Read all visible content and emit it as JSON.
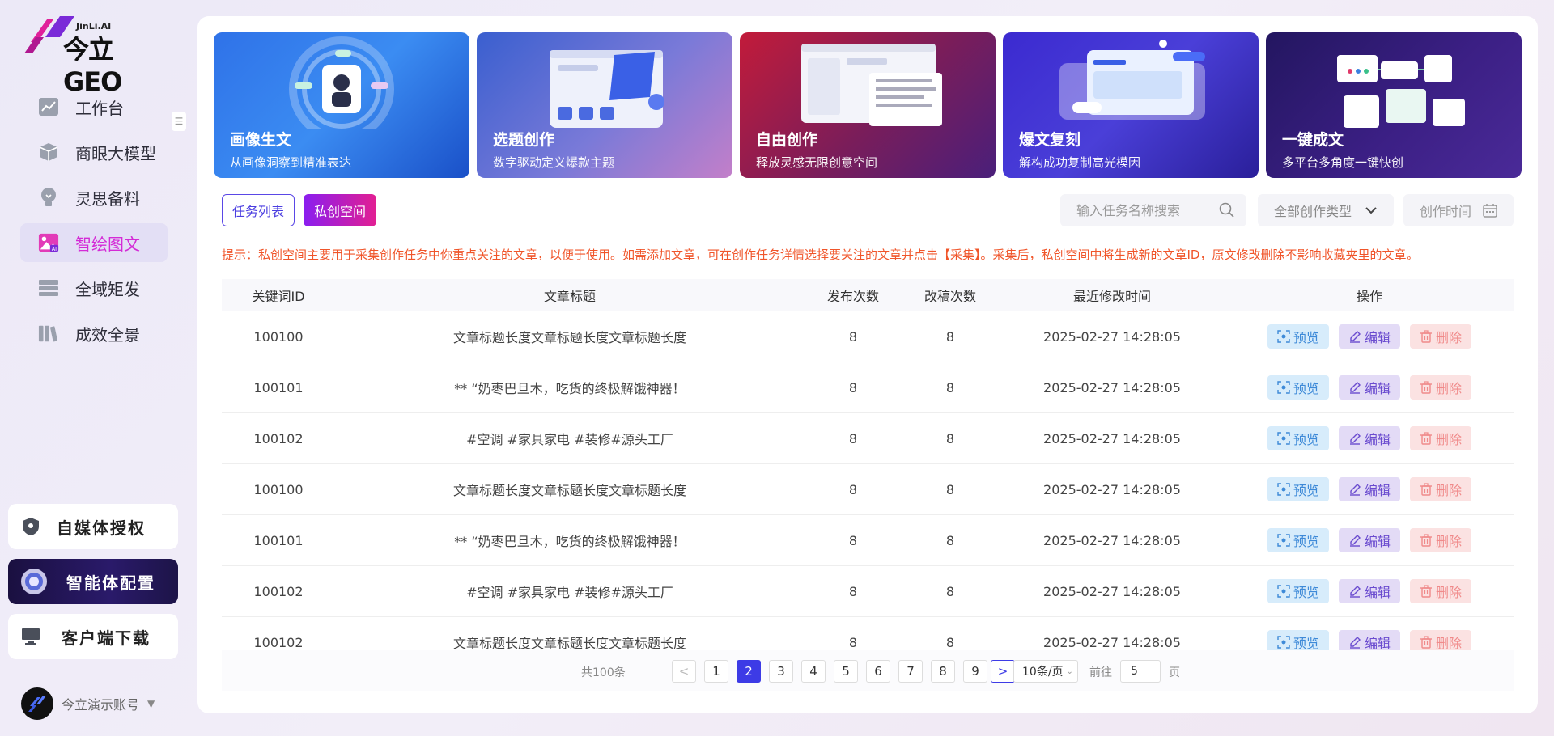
{
  "logo": {
    "small": "JinLi.AI",
    "big": "今立GEO"
  },
  "nav": [
    {
      "label": "工作台",
      "icon": "chart-line-icon"
    },
    {
      "label": "商眼大模型",
      "icon": "cube-icon"
    },
    {
      "label": "灵思备料",
      "icon": "lightbulb-icon"
    },
    {
      "label": "智绘图文",
      "icon": "ai-image-icon",
      "active": true
    },
    {
      "label": "全域矩发",
      "icon": "stack-icon"
    },
    {
      "label": "成效全景",
      "icon": "books-icon"
    }
  ],
  "side_cards": {
    "media_auth": "自媒体授权",
    "agent_config": "智能体配置",
    "client_download": "客户端下载"
  },
  "account": {
    "name": "今立演示账号"
  },
  "banners": [
    {
      "title": "画像生文",
      "subtitle": "从画像洞察到精准表达"
    },
    {
      "title": "选题创作",
      "subtitle": "数字驱动定义爆款主题"
    },
    {
      "title": "自由创作",
      "subtitle": "释放灵感无限创意空间"
    },
    {
      "title": "爆文复刻",
      "subtitle": "解构成功复制高光模因"
    },
    {
      "title": "一键成文",
      "subtitle": "多平台多角度一键快创"
    }
  ],
  "tabs": {
    "task_list": "任务列表",
    "private_space": "私创空间"
  },
  "filters": {
    "search_placeholder": "输入任务名称搜索",
    "type_select": "全部创作类型",
    "date_picker": "创作时间"
  },
  "tip": "提示：私创空间主要用于采集创作任务中你重点关注的文章，以便于使用。如需添加文章，可在创作任务详情选择要关注的文章并点击【采集】。采集后，私创空间中将生成新的文章ID，原文修改删除不影响收藏夹里的文章。",
  "table": {
    "headers": [
      "关键词ID",
      "文章标题",
      "发布次数",
      "改稿次数",
      "最近修改时间",
      "操作"
    ],
    "actions": {
      "preview": "预览",
      "edit": "编辑",
      "delete": "删除"
    },
    "rows": [
      {
        "id": "100100",
        "title": "文章标题长度文章标题长度文章标题长度",
        "publish": "8",
        "revise": "8",
        "time": "2025-02-27 14:28:05"
      },
      {
        "id": "100101",
        "title": "** “奶枣巴旦木，吃货的终极解饿神器！",
        "publish": "8",
        "revise": "8",
        "time": "2025-02-27 14:28:05"
      },
      {
        "id": "100102",
        "title": "#空调 #家具家电 #装修#源头工厂",
        "publish": "8",
        "revise": "8",
        "time": "2025-02-27 14:28:05"
      },
      {
        "id": "100100",
        "title": "文章标题长度文章标题长度文章标题长度",
        "publish": "8",
        "revise": "8",
        "time": "2025-02-27 14:28:05"
      },
      {
        "id": "100101",
        "title": "** “奶枣巴旦木，吃货的终极解饿神器！",
        "publish": "8",
        "revise": "8",
        "time": "2025-02-27 14:28:05"
      },
      {
        "id": "100102",
        "title": "#空调 #家具家电 #装修#源头工厂",
        "publish": "8",
        "revise": "8",
        "time": "2025-02-27 14:28:05"
      },
      {
        "id": "100102",
        "title": "文章标题长度文章标题长度文章标题长度",
        "publish": "8",
        "revise": "8",
        "time": "2025-02-27 14:28:05"
      }
    ]
  },
  "pagination": {
    "total": "共100条",
    "pages": [
      "1",
      "2",
      "3",
      "4",
      "5",
      "6",
      "7",
      "8",
      "9"
    ],
    "current": "2",
    "page_size": "10条/页",
    "goto_label": "前往",
    "goto_value": "5",
    "unit": "页"
  },
  "colors": {
    "accent": "#3d3be6",
    "active_nav": "#d42bd6",
    "tip": "#f0552a"
  }
}
